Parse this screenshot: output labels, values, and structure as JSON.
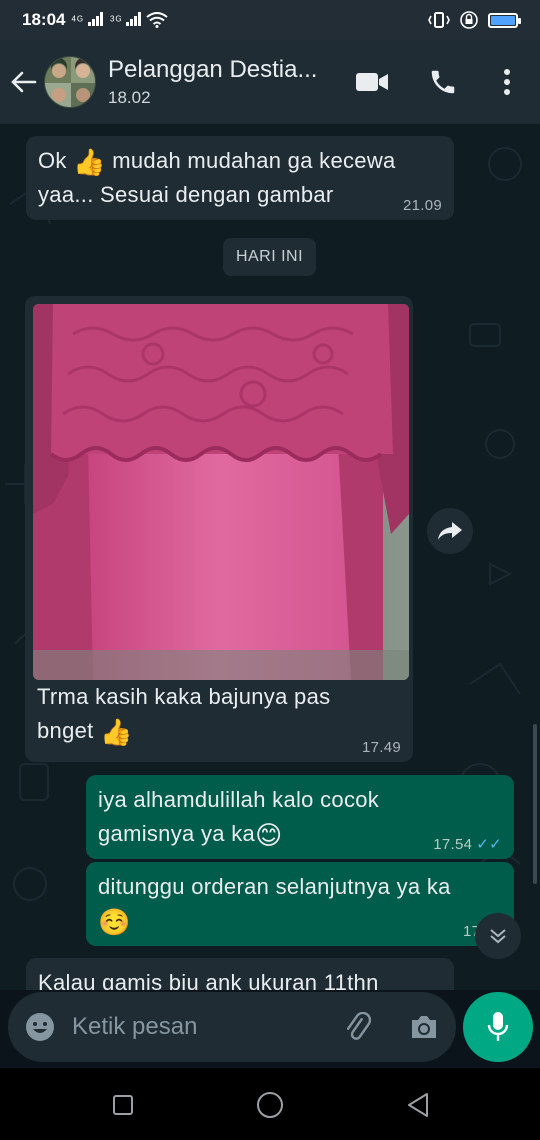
{
  "status_bar": {
    "time": "18:04",
    "signal1": "4G",
    "signal2": "3G",
    "battery_color": "#4fa3ff"
  },
  "header": {
    "contact_name": "Pelanggan Destia...",
    "subtitle": "18.02",
    "icons": [
      "back-arrow-icon",
      "video-call-icon",
      "phone-icon",
      "more-vert-icon"
    ]
  },
  "messages": [
    {
      "dir": "in",
      "text_line1": "Ok",
      "emoji1": "👍",
      "text_line1b": "mudah mudahan ga kecewa",
      "text_line2": "yaa... Sesuai dengan gambar",
      "time": "21.09"
    },
    {
      "dir": "in",
      "type": "image",
      "caption_line1": "Trma kasih kaka bajunya pas",
      "caption_line2": "bnget",
      "emoji": "👍",
      "time": "17.49"
    },
    {
      "dir": "out",
      "text_line1": "iya alhamdulillah kalo cocok",
      "text_line2": "gamisnya ya ka",
      "emoji": "😊",
      "time": "17.54",
      "status": "✓✓"
    },
    {
      "dir": "out",
      "text_line1": "ditunggu orderan selanjutnya ya ka",
      "emoji": "☺️",
      "time": "17.54"
    },
    {
      "dir": "in",
      "text_line1": "Kalau gamis biu ank ukuran 11thn"
    }
  ],
  "date_chip": "HARI INI",
  "composer": {
    "placeholder": "Ketik pesan",
    "icons": [
      "emoji-icon",
      "attach-icon",
      "camera-icon",
      "mic-icon"
    ]
  },
  "colors": {
    "accent": "#00a884",
    "outgoing_bubble": "#005c4b",
    "incoming_bubble": "#1f2c34",
    "read_tick": "#53bdeb"
  }
}
